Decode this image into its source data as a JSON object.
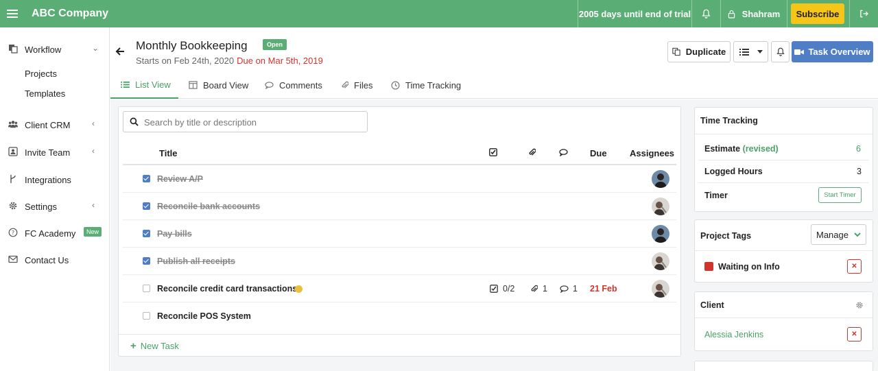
{
  "topbar": {
    "company": "ABC Company",
    "trial": "2005 days until end of trial",
    "user": "Shahram",
    "subscribe": "Subscribe"
  },
  "sidebar": {
    "workflow": "Workflow",
    "projects": "Projects",
    "templates": "Templates",
    "client_crm": "Client CRM",
    "invite_team": "Invite Team",
    "integrations": "Integrations",
    "settings": "Settings",
    "fc_academy": "FC Academy",
    "new_badge": "New",
    "contact_us": "Contact Us"
  },
  "task": {
    "title": "Monthly Bookkeeping",
    "status": "Open",
    "starts": "Starts on Feb 24th, 2020",
    "due": "Due on Mar 5th, 2019"
  },
  "actions": {
    "duplicate": "Duplicate",
    "task_overview": "Task Overview"
  },
  "tabs": {
    "list_view": "List View",
    "board_view": "Board View",
    "comments": "Comments",
    "files": "Files",
    "time_tracking": "Time Tracking"
  },
  "search": {
    "placeholder": "Search by title or description"
  },
  "table": {
    "title_col": "Title",
    "due_col": "Due",
    "assignees_col": "Assignees",
    "rows": [
      {
        "title": "Review A/P",
        "done": true
      },
      {
        "title": "Reconcile bank accounts",
        "done": true
      },
      {
        "title": "Pay bills",
        "done": true
      },
      {
        "title": "Publish all receipts",
        "done": true
      },
      {
        "title": "Reconcile credit card transactions",
        "done": false,
        "checklist": "0/2",
        "attachments": "1",
        "comments": "1",
        "due": "21 Feb"
      },
      {
        "title": "Reconcile POS System",
        "done": false
      }
    ],
    "new_task": "New Task"
  },
  "time_tracking": {
    "title": "Time Tracking",
    "estimate_label": "Estimate",
    "revised_label": "(revised)",
    "estimate_value": "6",
    "logged_label": "Logged Hours",
    "logged_value": "3",
    "timer_label": "Timer",
    "start_timer": "Start Timer"
  },
  "tags": {
    "title": "Project Tags",
    "manage": "Manage",
    "items": [
      {
        "name": "Waiting on Info",
        "color": "#d0342c"
      }
    ]
  },
  "client": {
    "title": "Client",
    "name": "Alessia Jenkins"
  },
  "colors": {
    "brand_green": "#5aae75",
    "accent_blue": "#4f7ec7",
    "danger_red": "#d0342c",
    "subscribe_yellow": "#f5c518"
  }
}
